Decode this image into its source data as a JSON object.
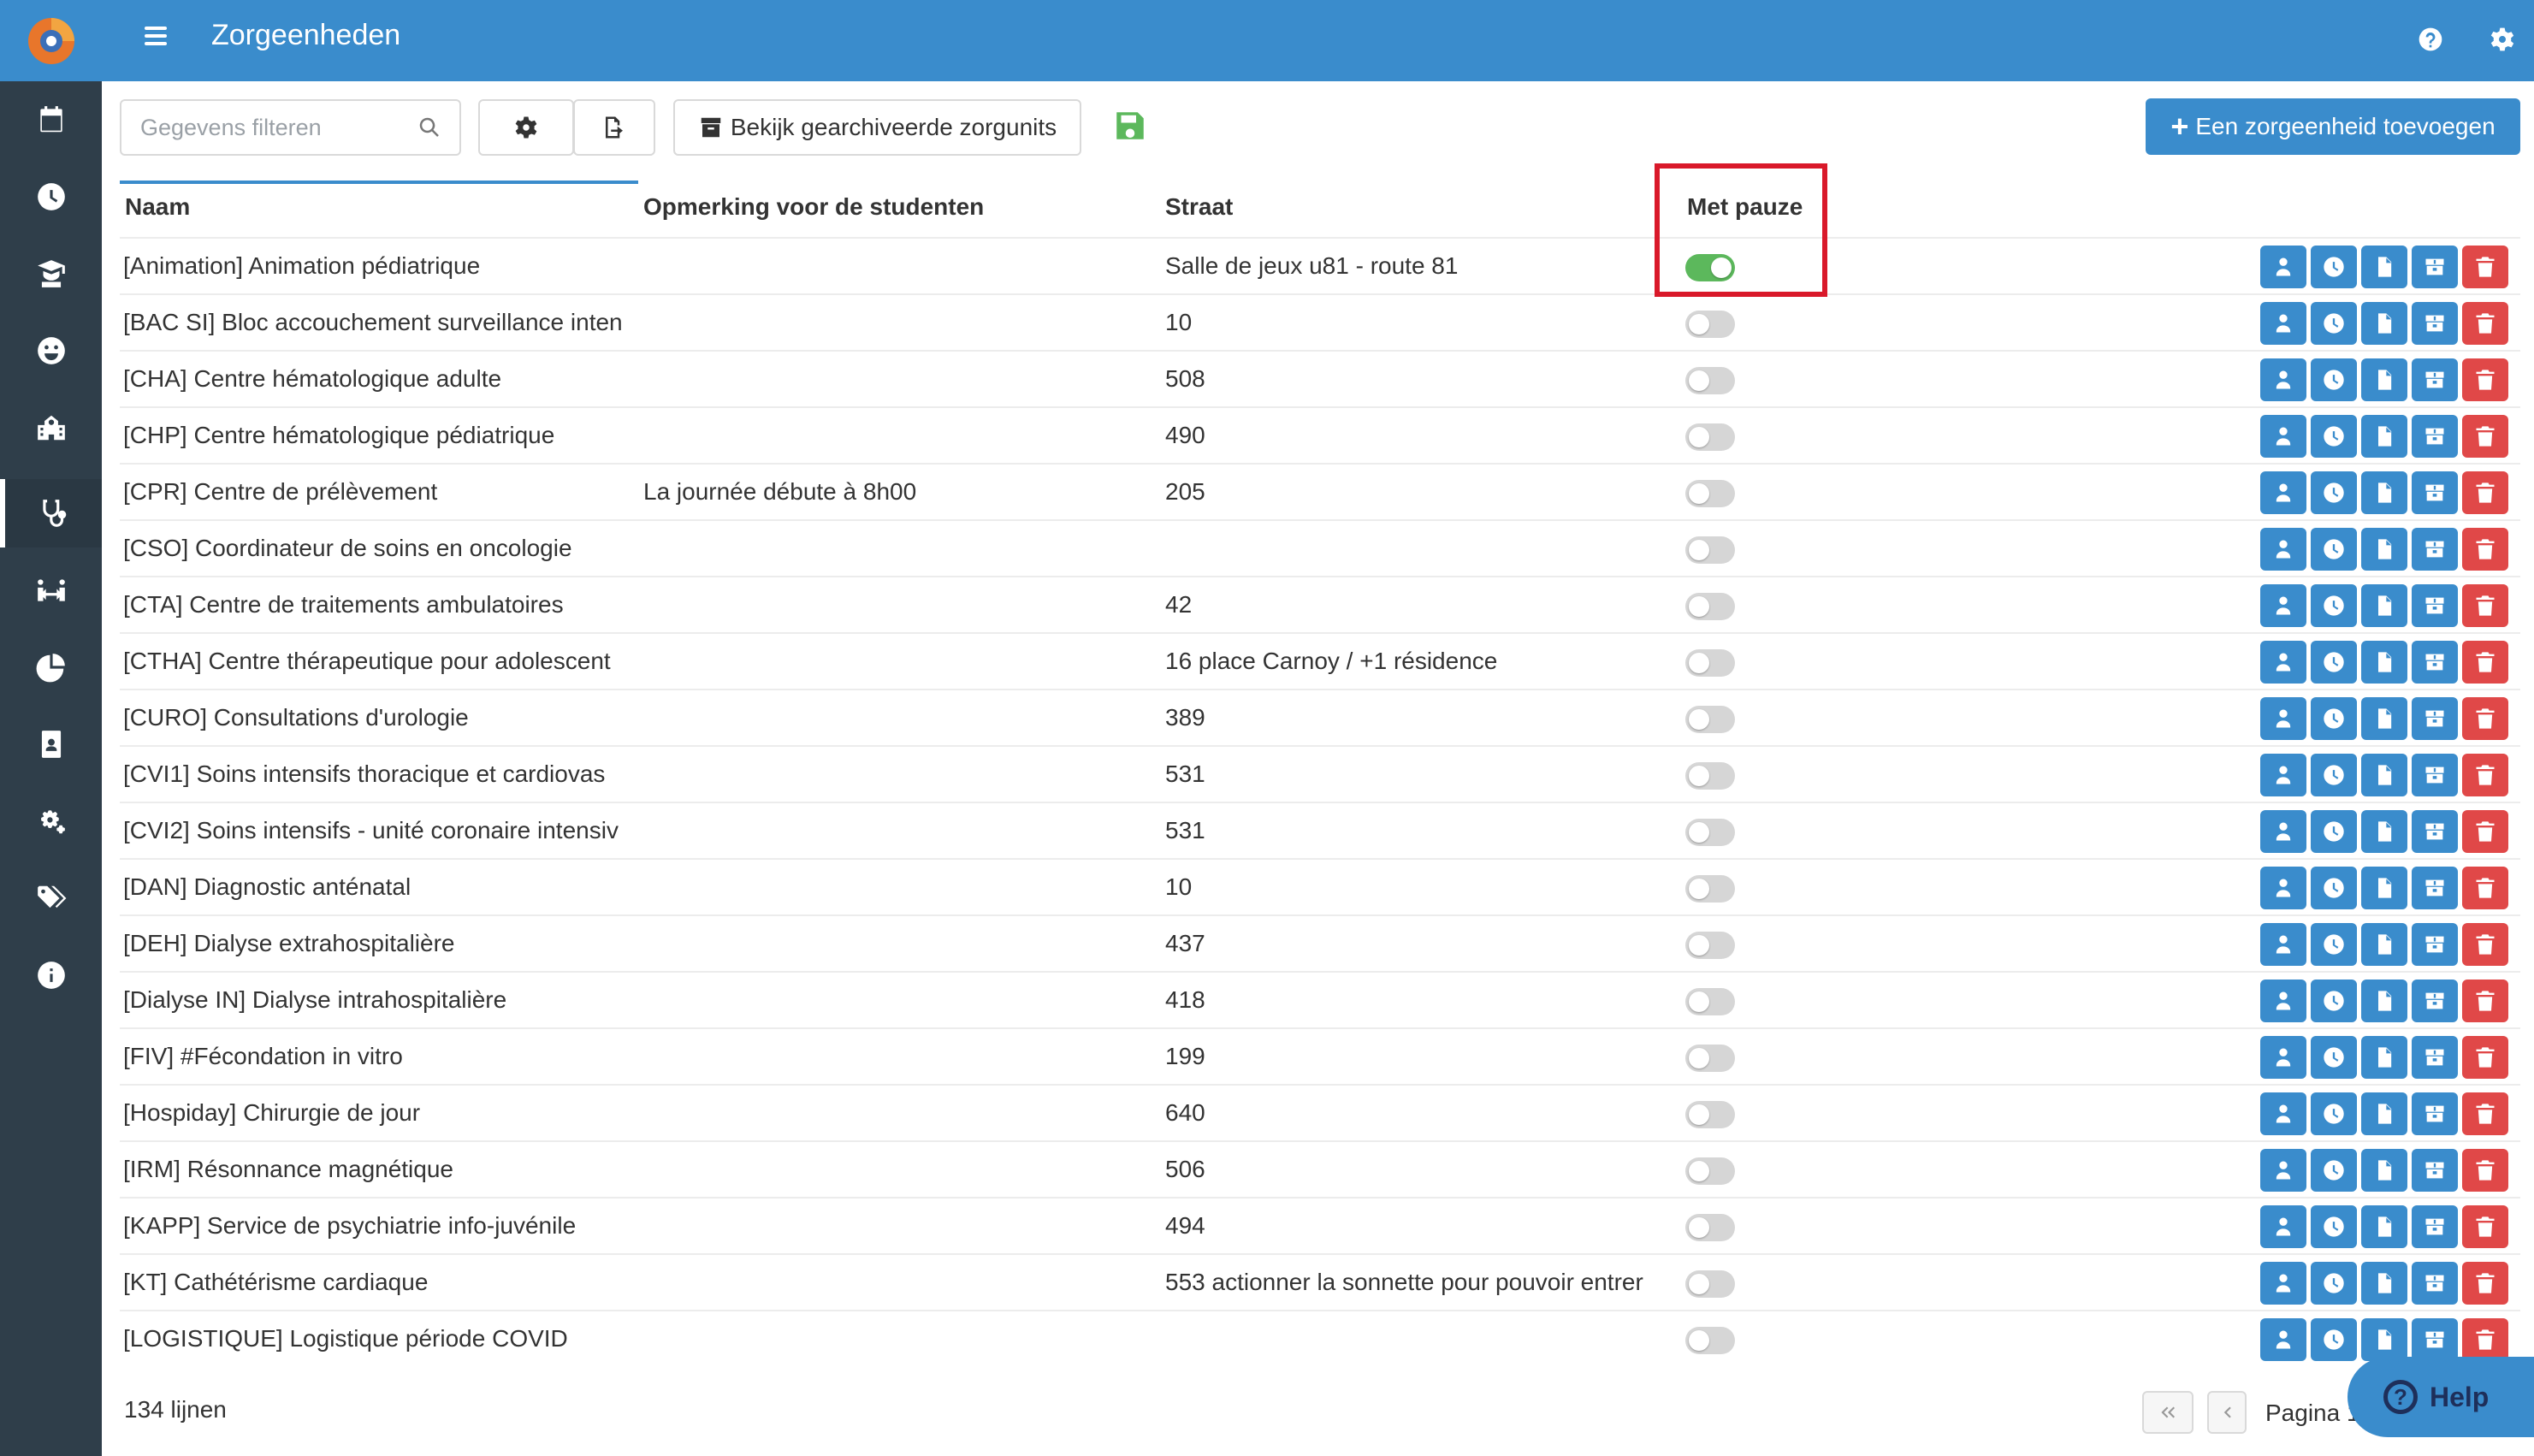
{
  "header": {
    "title": "Zorgeenheden"
  },
  "toolbar": {
    "search_placeholder": "Gegevens filteren",
    "archived_button": "Bekijk gearchiveerde zorgunits",
    "add_button": "Een zorgeenheid toevoegen"
  },
  "table": {
    "columns": [
      "Naam",
      "Opmerking voor de studenten",
      "Straat",
      "Met pauze"
    ],
    "rows": [
      {
        "name": "[Animation] Animation pédiatrique",
        "note": "",
        "street": "Salle de jeux u81 - route 81",
        "pause": true
      },
      {
        "name": "[BAC SI] Bloc accouchement surveillance inten",
        "note": "",
        "street": "10",
        "pause": false
      },
      {
        "name": "[CHA] Centre hématologique adulte",
        "note": "",
        "street": "508",
        "pause": false
      },
      {
        "name": "[CHP] Centre hématologique pédiatrique",
        "note": "",
        "street": "490",
        "pause": false
      },
      {
        "name": "[CPR] Centre de prélèvement",
        "note": "La journée débute à 8h00",
        "street": "205",
        "pause": false
      },
      {
        "name": "[CSO] Coordinateur de soins en oncologie",
        "note": "",
        "street": "",
        "pause": false
      },
      {
        "name": "[CTA] Centre de traitements ambulatoires",
        "note": "",
        "street": "42",
        "pause": false
      },
      {
        "name": "[CTHA] Centre thérapeutique pour adolescent",
        "note": "",
        "street": "16 place Carnoy / +1 résidence",
        "pause": false
      },
      {
        "name": "[CURO] Consultations d'urologie",
        "note": "",
        "street": "389",
        "pause": false
      },
      {
        "name": "[CVI1]  Soins intensifs thoracique et cardiovas",
        "note": "",
        "street": "531",
        "pause": false
      },
      {
        "name": "[CVI2] Soins intensifs - unité coronaire intensiv",
        "note": "",
        "street": "531",
        "pause": false
      },
      {
        "name": "[DAN] Diagnostic anténatal",
        "note": "",
        "street": "10",
        "pause": false
      },
      {
        "name": "[DEH] Dialyse extrahospitalière",
        "note": "",
        "street": "437",
        "pause": false
      },
      {
        "name": "[Dialyse IN] Dialyse intrahospitalière",
        "note": "",
        "street": "418",
        "pause": false
      },
      {
        "name": "[FIV]  #Fécondation in vitro",
        "note": "",
        "street": "199",
        "pause": false
      },
      {
        "name": "[Hospiday] Chirurgie de jour",
        "note": "",
        "street": "640",
        "pause": false
      },
      {
        "name": "[IRM] Résonnance magnétique",
        "note": "",
        "street": "506",
        "pause": false
      },
      {
        "name": "[KAPP] Service de psychiatrie info-juvénile",
        "note": "",
        "street": "494",
        "pause": false
      },
      {
        "name": "[KT] Cathétérisme cardiaque",
        "note": "",
        "street": "553 actionner la sonnette pour pouvoir entrer",
        "pause": false
      },
      {
        "name": "[LOGISTIQUE] Logistique période COVID",
        "note": "",
        "street": "",
        "pause": false
      }
    ]
  },
  "footer": {
    "count": "134 lijnen",
    "page_label": "Pagina 1",
    "help": "Help"
  },
  "colors": {
    "header": "#3a8ccc",
    "sidebar": "#2f3e4a",
    "toggle_on": "#5cb85c",
    "delete": "#e04848",
    "highlight": "#d9192a"
  }
}
